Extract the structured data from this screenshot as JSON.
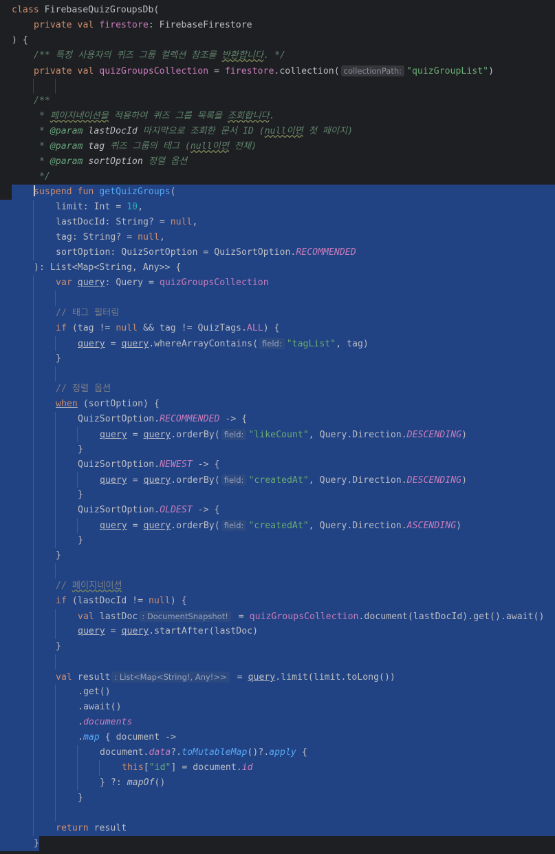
{
  "editor": {
    "lines": [
      {
        "indent": 0,
        "sel": false,
        "tokens": [
          {
            "t": "class ",
            "c": "k"
          },
          {
            "t": "FirebaseQuizGroupsDb("
          }
        ]
      },
      {
        "indent": 1,
        "sel": false,
        "tokens": [
          {
            "t": "private ",
            "c": "k"
          },
          {
            "t": "val ",
            "c": "k"
          },
          {
            "t": "firestore",
            "c": "p"
          },
          {
            "t": ": FirebaseFirestore"
          }
        ]
      },
      {
        "indent": 0,
        "sel": false,
        "tokens": [
          {
            "t": ") {"
          }
        ]
      },
      {
        "indent": 1,
        "sel": false,
        "tokens": [
          {
            "t": "/** ",
            "c": "dc"
          },
          {
            "t": "특정 사용자의",
            "c": "dc u2"
          },
          {
            "t": " 퀴즈 그룹 컬렉션 참조를 ",
            "c": "dc"
          },
          {
            "t": "반환합니다",
            "c": "dc squig"
          },
          {
            "t": ". */",
            "c": "dc"
          }
        ]
      },
      {
        "indent": 1,
        "sel": false,
        "tokens": [
          {
            "t": "private ",
            "c": "k"
          },
          {
            "t": "val ",
            "c": "k"
          },
          {
            "t": "quizGroupsCollection",
            "c": "p"
          },
          {
            "t": " = "
          },
          {
            "t": "firestore",
            "c": "p"
          },
          {
            "t": ".collection("
          },
          {
            "t": "collectionPath:",
            "c": "hint"
          },
          {
            "t": "\"quizGroupList\"",
            "c": "s"
          },
          {
            "t": ")"
          }
        ]
      },
      {
        "indent": 0,
        "sel": false,
        "tokens": []
      },
      {
        "indent": 1,
        "sel": false,
        "tokens": [
          {
            "t": "/**",
            "c": "dc"
          }
        ]
      },
      {
        "indent": 1,
        "sel": false,
        "tokens": [
          {
            "t": " * ",
            "c": "dc"
          },
          {
            "t": "페이지네이션을",
            "c": "dc squig"
          },
          {
            "t": " 적용하여 퀴즈 그룹 목록을 ",
            "c": "dc"
          },
          {
            "t": "조회합니다",
            "c": "dc squig"
          },
          {
            "t": ".",
            "c": "dc"
          }
        ]
      },
      {
        "indent": 1,
        "sel": false,
        "tokens": [
          {
            "t": " * ",
            "c": "dc"
          },
          {
            "t": "@param ",
            "c": "dt"
          },
          {
            "t": "lastDocId ",
            "c": "fi"
          },
          {
            "t": "마지막으로 조회한 문서 ID (",
            "c": "dc"
          },
          {
            "t": "null이면",
            "c": "dc squig"
          },
          {
            "t": " 첫 페이지)",
            "c": "dc"
          }
        ]
      },
      {
        "indent": 1,
        "sel": false,
        "tokens": [
          {
            "t": " * ",
            "c": "dc"
          },
          {
            "t": "@param ",
            "c": "dt"
          },
          {
            "t": "tag ",
            "c": "fi"
          },
          {
            "t": "퀴즈 그룹의 태그 (",
            "c": "dc"
          },
          {
            "t": "null이면",
            "c": "dc squig"
          },
          {
            "t": " 전체)",
            "c": "dc"
          }
        ]
      },
      {
        "indent": 1,
        "sel": false,
        "tokens": [
          {
            "t": " * ",
            "c": "dc"
          },
          {
            "t": "@param ",
            "c": "dt"
          },
          {
            "t": "sortOption ",
            "c": "fi"
          },
          {
            "t": "정렬 옵션",
            "c": "dc"
          }
        ]
      },
      {
        "indent": 1,
        "sel": false,
        "tokens": [
          {
            "t": " */",
            "c": "dc"
          }
        ]
      },
      {
        "indent": 1,
        "sel": "partial",
        "caret": true,
        "tokens": [
          {
            "t": "suspend ",
            "c": "k"
          },
          {
            "t": "fun ",
            "c": "k"
          },
          {
            "t": "getQuizGroups",
            "c": "f"
          },
          {
            "t": "("
          }
        ]
      },
      {
        "indent": 2,
        "sel": true,
        "tokens": [
          {
            "t": "limit: Int = "
          },
          {
            "t": "10",
            "c": "n"
          },
          {
            "t": ","
          }
        ]
      },
      {
        "indent": 2,
        "sel": true,
        "tokens": [
          {
            "t": "lastDocId: String? = "
          },
          {
            "t": "null",
            "c": "k"
          },
          {
            "t": ","
          }
        ]
      },
      {
        "indent": 2,
        "sel": true,
        "tokens": [
          {
            "t": "tag: String? = "
          },
          {
            "t": "null",
            "c": "k"
          },
          {
            "t": ","
          }
        ]
      },
      {
        "indent": 2,
        "sel": true,
        "tokens": [
          {
            "t": "sortOption: QuizSortOption = QuizSortOption."
          },
          {
            "t": "RECOMMENDED",
            "c": "st"
          }
        ]
      },
      {
        "indent": 1,
        "sel": true,
        "tokens": [
          {
            "t": "): List<Map<String, Any>> {"
          }
        ]
      },
      {
        "indent": 2,
        "sel": true,
        "tokens": [
          {
            "t": "var ",
            "c": "k"
          },
          {
            "t": "query",
            "c": "u"
          },
          {
            "t": ": Query = "
          },
          {
            "t": "quizGroupsCollection",
            "c": "p"
          }
        ]
      },
      {
        "indent": 0,
        "sel": true,
        "tokens": []
      },
      {
        "indent": 2,
        "sel": true,
        "tokens": [
          {
            "t": "// 태그 필터링",
            "c": "cm"
          }
        ]
      },
      {
        "indent": 2,
        "sel": true,
        "tokens": [
          {
            "t": "if ",
            "c": "k"
          },
          {
            "t": "(tag != "
          },
          {
            "t": "null",
            "c": "k"
          },
          {
            "t": " && tag != QuizTags."
          },
          {
            "t": "ALL",
            "c": "p"
          },
          {
            "t": ") {"
          }
        ]
      },
      {
        "indent": 3,
        "sel": true,
        "tokens": [
          {
            "t": "query",
            "c": "u"
          },
          {
            "t": " = "
          },
          {
            "t": "query",
            "c": "u"
          },
          {
            "t": ".whereArrayContains("
          },
          {
            "t": "field:",
            "c": "hint"
          },
          {
            "t": "\"tagList\"",
            "c": "s"
          },
          {
            "t": ", tag)"
          }
        ]
      },
      {
        "indent": 2,
        "sel": true,
        "tokens": [
          {
            "t": "}"
          }
        ]
      },
      {
        "indent": 0,
        "sel": true,
        "tokens": []
      },
      {
        "indent": 2,
        "sel": true,
        "tokens": [
          {
            "t": "// 정렬 옵션",
            "c": "cm"
          }
        ]
      },
      {
        "indent": 2,
        "sel": true,
        "tokens": [
          {
            "t": "when",
            "c": "k u"
          },
          {
            "t": " (sortOption) {"
          }
        ]
      },
      {
        "indent": 3,
        "sel": true,
        "tokens": [
          {
            "t": "QuizSortOption."
          },
          {
            "t": "RECOMMENDED",
            "c": "st"
          },
          {
            "t": " -> {"
          }
        ]
      },
      {
        "indent": 4,
        "sel": true,
        "tokens": [
          {
            "t": "query",
            "c": "u"
          },
          {
            "t": " = "
          },
          {
            "t": "query",
            "c": "u"
          },
          {
            "t": ".orderBy("
          },
          {
            "t": "field:",
            "c": "hint"
          },
          {
            "t": "\"likeCount\"",
            "c": "s"
          },
          {
            "t": ", Query.Direction."
          },
          {
            "t": "DESCENDING",
            "c": "st"
          },
          {
            "t": ")"
          }
        ]
      },
      {
        "indent": 3,
        "sel": true,
        "tokens": [
          {
            "t": "}"
          }
        ]
      },
      {
        "indent": 3,
        "sel": true,
        "tokens": [
          {
            "t": "QuizSortOption."
          },
          {
            "t": "NEWEST",
            "c": "st"
          },
          {
            "t": " -> {"
          }
        ]
      },
      {
        "indent": 4,
        "sel": true,
        "tokens": [
          {
            "t": "query",
            "c": "u"
          },
          {
            "t": " = "
          },
          {
            "t": "query",
            "c": "u"
          },
          {
            "t": ".orderBy("
          },
          {
            "t": "field:",
            "c": "hint"
          },
          {
            "t": "\"createdAt\"",
            "c": "s"
          },
          {
            "t": ", Query.Direction."
          },
          {
            "t": "DESCENDING",
            "c": "st"
          },
          {
            "t": ")"
          }
        ]
      },
      {
        "indent": 3,
        "sel": true,
        "tokens": [
          {
            "t": "}"
          }
        ]
      },
      {
        "indent": 3,
        "sel": true,
        "tokens": [
          {
            "t": "QuizSortOption."
          },
          {
            "t": "OLDEST",
            "c": "st"
          },
          {
            "t": " -> {"
          }
        ]
      },
      {
        "indent": 4,
        "sel": true,
        "tokens": [
          {
            "t": "query",
            "c": "u"
          },
          {
            "t": " = "
          },
          {
            "t": "query",
            "c": "u"
          },
          {
            "t": ".orderBy("
          },
          {
            "t": "field:",
            "c": "hint"
          },
          {
            "t": "\"createdAt\"",
            "c": "s"
          },
          {
            "t": ", Query.Direction."
          },
          {
            "t": "ASCENDING",
            "c": "st"
          },
          {
            "t": ")"
          }
        ]
      },
      {
        "indent": 3,
        "sel": true,
        "tokens": [
          {
            "t": "}"
          }
        ]
      },
      {
        "indent": 2,
        "sel": true,
        "tokens": [
          {
            "t": "}"
          }
        ]
      },
      {
        "indent": 0,
        "sel": true,
        "tokens": []
      },
      {
        "indent": 2,
        "sel": true,
        "tokens": [
          {
            "t": "// ",
            "c": "cm"
          },
          {
            "t": "페이지네이션",
            "c": "cm squig"
          }
        ]
      },
      {
        "indent": 2,
        "sel": true,
        "tokens": [
          {
            "t": "if ",
            "c": "k"
          },
          {
            "t": "(lastDocId != "
          },
          {
            "t": "null",
            "c": "k"
          },
          {
            "t": ") {"
          }
        ]
      },
      {
        "indent": 3,
        "sel": true,
        "tokens": [
          {
            "t": "val ",
            "c": "k"
          },
          {
            "t": "lastDoc"
          },
          {
            "t": ": DocumentSnapshot!",
            "c": "hint"
          },
          {
            "t": " = "
          },
          {
            "t": "quizGroupsCollection",
            "c": "p"
          },
          {
            "t": ".document(lastDocId).get().await()"
          }
        ]
      },
      {
        "indent": 3,
        "sel": true,
        "tokens": [
          {
            "t": "query",
            "c": "u"
          },
          {
            "t": " = "
          },
          {
            "t": "query",
            "c": "u"
          },
          {
            "t": ".startAfter(lastDoc)"
          }
        ]
      },
      {
        "indent": 2,
        "sel": true,
        "tokens": [
          {
            "t": "}"
          }
        ]
      },
      {
        "indent": 0,
        "sel": true,
        "tokens": []
      },
      {
        "indent": 2,
        "sel": true,
        "tokens": [
          {
            "t": "val ",
            "c": "k"
          },
          {
            "t": "result"
          },
          {
            "t": ": List<Map<String!, Any!>>",
            "c": "hint"
          },
          {
            "t": " = "
          },
          {
            "t": "query",
            "c": "u"
          },
          {
            "t": ".limit(limit.toLong())"
          }
        ]
      },
      {
        "indent": 3,
        "sel": true,
        "tokens": [
          {
            "t": ".get()"
          }
        ]
      },
      {
        "indent": 3,
        "sel": true,
        "tokens": [
          {
            "t": ".await()"
          }
        ]
      },
      {
        "indent": 3,
        "sel": true,
        "tokens": [
          {
            "t": "."
          },
          {
            "t": "documents",
            "c": "st"
          }
        ]
      },
      {
        "indent": 3,
        "sel": true,
        "tokens": [
          {
            "t": "."
          },
          {
            "t": "map",
            "c": "ext"
          },
          {
            "t": " { document ->"
          }
        ]
      },
      {
        "indent": 4,
        "sel": true,
        "tokens": [
          {
            "t": "document."
          },
          {
            "t": "data",
            "c": "st"
          },
          {
            "t": "?."
          },
          {
            "t": "toMutableMap",
            "c": "ext"
          },
          {
            "t": "()?."
          },
          {
            "t": "apply",
            "c": "ext"
          },
          {
            "t": " {"
          }
        ]
      },
      {
        "indent": 5,
        "sel": true,
        "tokens": [
          {
            "t": "this",
            "c": "k"
          },
          {
            "t": "["
          },
          {
            "t": "\"id\"",
            "c": "s"
          },
          {
            "t": "] = document."
          },
          {
            "t": "id",
            "c": "st"
          }
        ]
      },
      {
        "indent": 4,
        "sel": true,
        "tokens": [
          {
            "t": "} ?: "
          },
          {
            "t": "mapOf",
            "c": "fi"
          },
          {
            "t": "()"
          }
        ]
      },
      {
        "indent": 3,
        "sel": true,
        "tokens": [
          {
            "t": "}"
          }
        ]
      },
      {
        "indent": 0,
        "sel": true,
        "tokens": []
      },
      {
        "indent": 2,
        "sel": true,
        "tokens": [
          {
            "t": "return ",
            "c": "k"
          },
          {
            "t": "result"
          }
        ]
      },
      {
        "indent": 1,
        "sel": "end",
        "tokens": [
          {
            "t": "}"
          }
        ]
      }
    ]
  }
}
